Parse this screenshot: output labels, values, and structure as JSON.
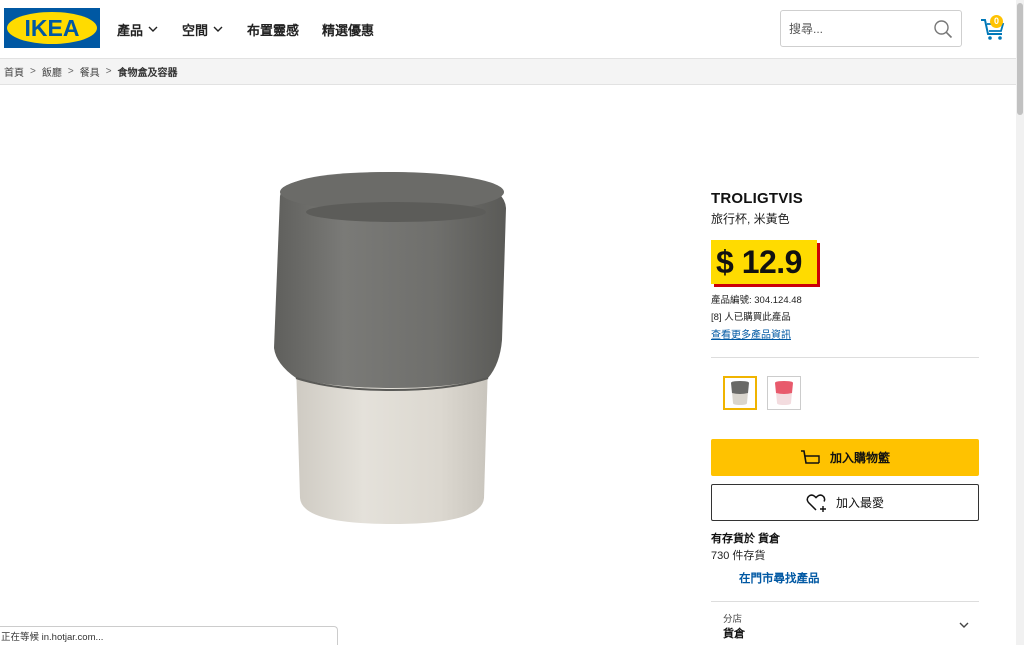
{
  "header": {
    "logo_text": "IKEA",
    "nav": [
      {
        "label": "產品",
        "has_dropdown": true
      },
      {
        "label": "空間",
        "has_dropdown": true
      },
      {
        "label": "布置靈感",
        "has_dropdown": false
      },
      {
        "label": "精選優惠",
        "has_dropdown": false
      }
    ],
    "search_placeholder": "搜尋...",
    "search_icon": "search-icon",
    "cart_icon": "cart-icon",
    "cart_count": "0"
  },
  "breadcrumb": {
    "items": [
      "首頁",
      "飯廳",
      "餐具",
      "食物盒及容器"
    ],
    "separator": ">"
  },
  "product": {
    "name": "TROLIGTVIS",
    "description": "旅行杯, 米黃色",
    "price": "$ 12.9",
    "article_number": "產品編號: 304.124.48",
    "purchased_count": "[8] 人已購買此產品",
    "more_info_link": "查看更多產品資訊",
    "variants": [
      {
        "name": "grey-beige",
        "selected": true
      },
      {
        "name": "pink",
        "selected": false
      }
    ],
    "add_to_cart": "加入購物籃",
    "add_to_favorites": "加入最愛",
    "stock_title": "有存貨於 貨倉",
    "stock_count": "730 件存貨",
    "find_in_store": "在門市尋找產品",
    "store_label": "分店",
    "store_value": "貨倉"
  },
  "status_bar": "正在等候 in.hotjar.com...",
  "colors": {
    "ikea_blue": "#0058a3",
    "ikea_yellow": "#ffdb00",
    "cart_button": "#ffc200",
    "price_shadow": "#cc0008",
    "link": "#0058a3"
  }
}
